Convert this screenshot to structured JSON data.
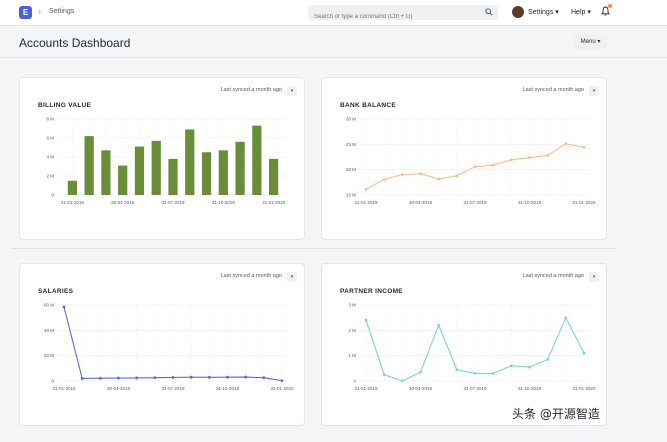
{
  "app": {
    "logo_letter": "E",
    "breadcrumb": "Settings"
  },
  "search": {
    "placeholder": "Search or type a command (Ctrl + G)"
  },
  "nav": {
    "settings_label": "Settings",
    "help_label": "Help"
  },
  "page": {
    "title": "Accounts Dashboard",
    "menu_label": "Menu"
  },
  "colors": {
    "billing": "#6a8d3a",
    "bank": "#f6c08a",
    "salaries": "#5b6bd8",
    "partner": "#7fd3de"
  },
  "watermark": "头条 @开源智造",
  "cards": [
    {
      "title": "BILLING VALUE",
      "sync": "Last synced a month ago"
    },
    {
      "title": "BANK BALANCE",
      "sync": "Last synced a month ago"
    },
    {
      "title": "SALARIES",
      "sync": "Last synced a month ago"
    },
    {
      "title": "PARTNER INCOME",
      "sync": "Last synced a month ago"
    }
  ],
  "chart_data": [
    {
      "type": "bar",
      "title": "BILLING VALUE",
      "y_ticks": [
        "0",
        "2 M",
        "4 M",
        "6 M",
        "8 M"
      ],
      "ylim": [
        0,
        8
      ],
      "x_ticks": [
        "31-01-2019",
        "30-04-2019",
        "31-07-2019",
        "31-10-2019",
        "31-01-2020"
      ],
      "values": [
        1.5,
        6.2,
        4.7,
        3.1,
        5.1,
        5.7,
        3.8,
        6.9,
        4.5,
        4.7,
        5.6,
        7.3,
        3.8
      ]
    },
    {
      "type": "line",
      "title": "BANK BALANCE",
      "y_ticks": [
        "15 M",
        "20 M",
        "25 M",
        "30 M"
      ],
      "ylim": [
        12.5,
        30
      ],
      "x_ticks": [
        "31-01-2019",
        "30-04-2019",
        "31-07-2019",
        "31-10-2019",
        "31-01-2020"
      ],
      "values": [
        13.8,
        16.1,
        17.2,
        17.4,
        16.2,
        16.9,
        19.0,
        19.4,
        20.6,
        21.1,
        21.6,
        24.3,
        23.5
      ]
    },
    {
      "type": "line",
      "title": "SALARIES",
      "y_ticks": [
        "0",
        "20 M",
        "40 M",
        "60 M"
      ],
      "ylim": [
        0,
        60
      ],
      "x_ticks": [
        "31-01-2019",
        "30-04-2019",
        "31-07-2019",
        "31-10-2019",
        "31-01-2020"
      ],
      "values": [
        58.5,
        2.0,
        2.2,
        2.3,
        2.4,
        2.6,
        2.8,
        3.0,
        2.9,
        3.0,
        3.1,
        2.6,
        0.3
      ]
    },
    {
      "type": "line",
      "title": "PARTNER INCOME",
      "y_ticks": [
        "0",
        "1 M",
        "2 M",
        "3 M"
      ],
      "ylim": [
        0,
        3
      ],
      "x_ticks": [
        "31-01-2019",
        "30-04-2019",
        "31-07-2019",
        "31-10-2019",
        "31-01-2020"
      ],
      "values": [
        2.4,
        0.25,
        0.0,
        0.35,
        2.2,
        0.45,
        0.3,
        0.3,
        0.6,
        0.55,
        0.85,
        2.5,
        1.1
      ]
    }
  ]
}
